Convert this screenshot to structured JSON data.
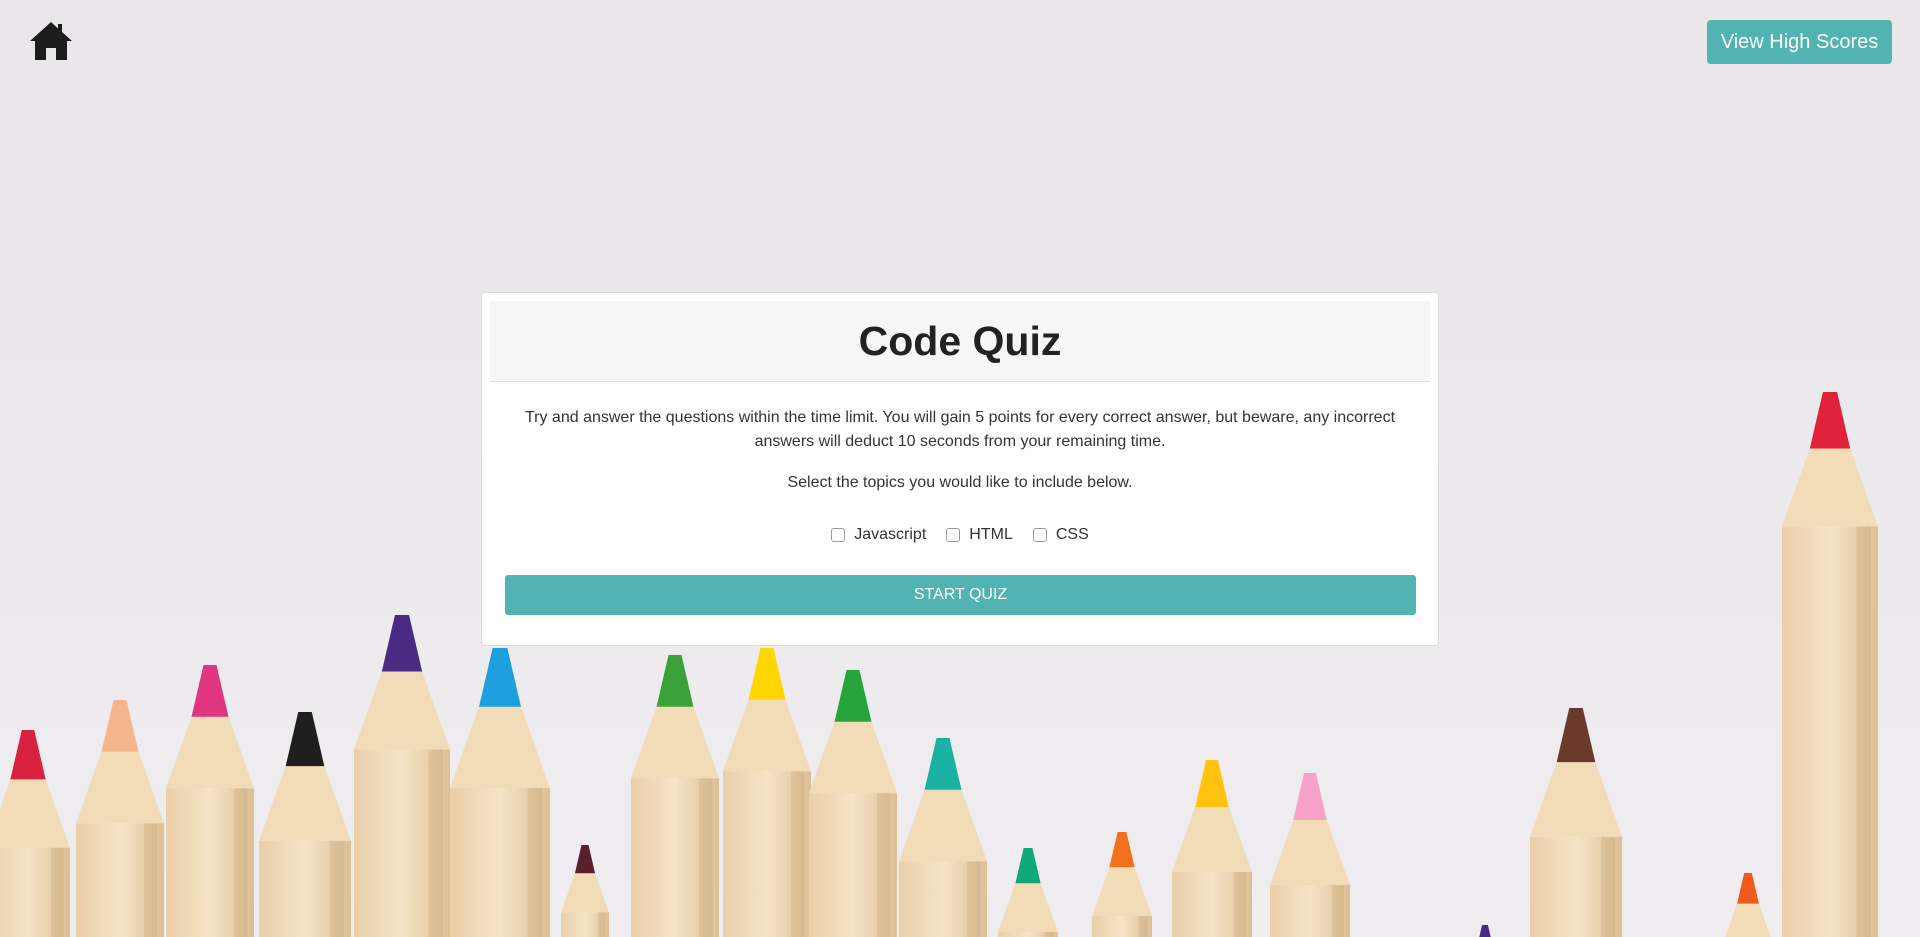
{
  "nav": {
    "home_icon": "home-icon",
    "high_scores_label": "View High Scores"
  },
  "quiz": {
    "title": "Code Quiz",
    "description": "Try and answer the questions within the time limit. You will gain 5 points for every correct answer, but beware, any incorrect answers will deduct 10 seconds from your remaining time.",
    "select_prompt": "Select the topics you would like to include below.",
    "topics": [
      {
        "label": "Javascript",
        "checked": false
      },
      {
        "label": "HTML",
        "checked": false
      },
      {
        "label": "CSS",
        "checked": false
      }
    ],
    "start_label": "START QUIZ"
  },
  "colors": {
    "accent": "#52b4b2",
    "background": "#ebe8ec"
  }
}
